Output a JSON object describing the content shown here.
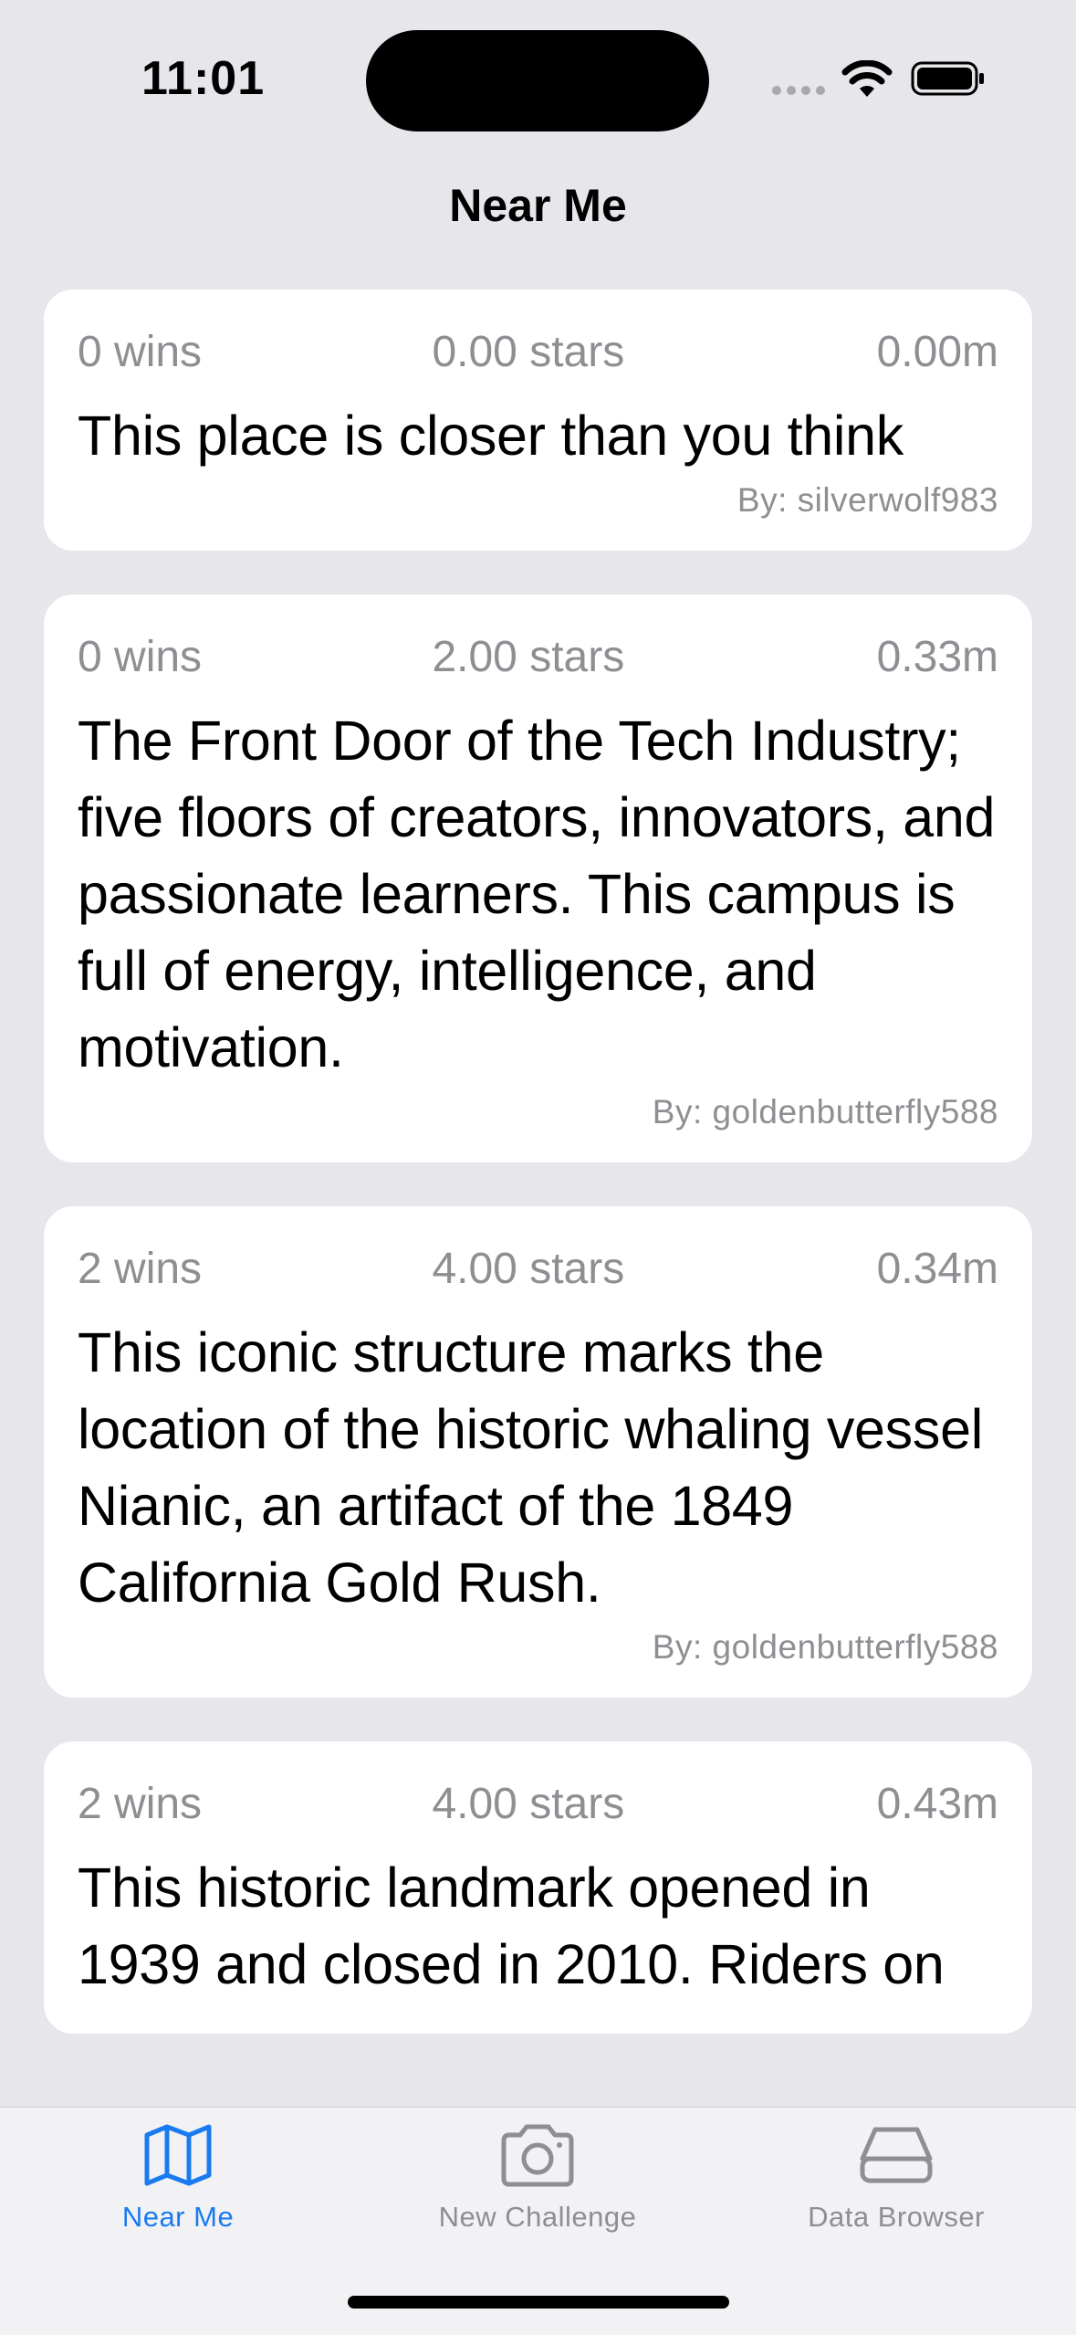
{
  "status_bar": {
    "time": "11:01"
  },
  "nav": {
    "title": "Near Me"
  },
  "challenges": [
    {
      "wins": "0 wins",
      "stars": "0.00 stars",
      "distance": "0.00m",
      "description": "This place is closer than you think",
      "author": "By: silverwolf983"
    },
    {
      "wins": "0 wins",
      "stars": "2.00 stars",
      "distance": "0.33m",
      "description": "The Front Door of the Tech Industry; five floors of creators, innovators, and passionate learners. This campus is full of energy, intelligence, and motivation.",
      "author": "By: goldenbutterfly588"
    },
    {
      "wins": "2 wins",
      "stars": "4.00 stars",
      "distance": "0.34m",
      "description": "This iconic structure marks the location of the historic whaling vessel Nianic, an artifact of the 1849 California Gold Rush.",
      "author": "By: goldenbutterfly588"
    },
    {
      "wins": "2 wins",
      "stars": "4.00 stars",
      "distance": "0.43m",
      "description": "This historic landmark opened in 1939 and closed in 2010. Riders on",
      "author": ""
    }
  ],
  "tabs": [
    {
      "label": "Near Me",
      "icon": "map-icon",
      "active": true
    },
    {
      "label": "New Challenge",
      "icon": "camera-icon",
      "active": false
    },
    {
      "label": "Data Browser",
      "icon": "drive-icon",
      "active": false
    }
  ],
  "colors": {
    "accent": "#1A7BF0",
    "secondary_text": "#8E8E93",
    "background": "#E6E6EB"
  }
}
